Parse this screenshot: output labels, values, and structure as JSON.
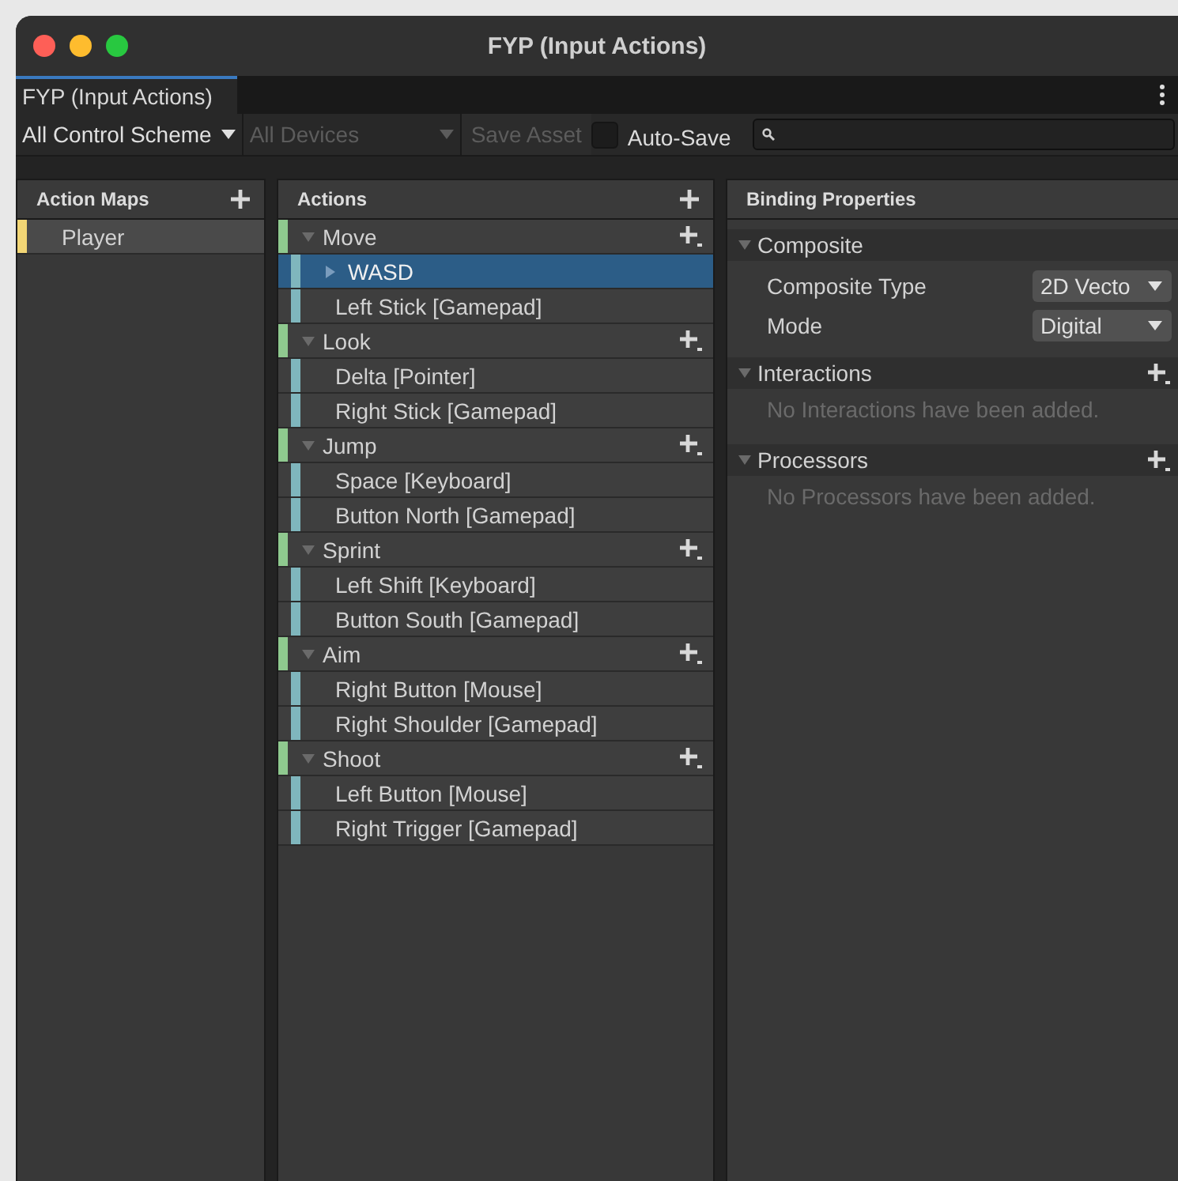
{
  "window": {
    "title": "FYP (Input Actions)"
  },
  "tabs": [
    {
      "label": "FYP (Input Actions)",
      "selected": true
    }
  ],
  "toolbar": {
    "control_scheme": "All Control Scheme",
    "devices": {
      "label": "All Devices",
      "disabled": true
    },
    "save_button": {
      "label": "Save Asset",
      "disabled": true
    },
    "auto_save": {
      "label": "Auto-Save",
      "checked": false
    }
  },
  "action_maps": {
    "title": "Action Maps",
    "items": [
      {
        "label": "Player",
        "selected": true
      }
    ]
  },
  "actions": {
    "title": "Actions",
    "items": [
      {
        "name": "Move",
        "expanded": true,
        "bindings": [
          {
            "label": "WASD",
            "kind": "composite",
            "expanded": false,
            "selected": true
          },
          {
            "label": "Left Stick [Gamepad]",
            "kind": "binding",
            "selected": false
          }
        ]
      },
      {
        "name": "Look",
        "expanded": true,
        "bindings": [
          {
            "label": "Delta [Pointer]",
            "kind": "binding",
            "selected": false
          },
          {
            "label": "Right Stick [Gamepad]",
            "kind": "binding",
            "selected": false
          }
        ]
      },
      {
        "name": "Jump",
        "expanded": true,
        "bindings": [
          {
            "label": "Space [Keyboard]",
            "kind": "binding",
            "selected": false
          },
          {
            "label": "Button North [Gamepad]",
            "kind": "binding",
            "selected": false
          }
        ]
      },
      {
        "name": "Sprint",
        "expanded": true,
        "bindings": [
          {
            "label": "Left Shift [Keyboard]",
            "kind": "binding",
            "selected": false
          },
          {
            "label": "Button South [Gamepad]",
            "kind": "binding",
            "selected": false
          }
        ]
      },
      {
        "name": "Aim",
        "expanded": true,
        "bindings": [
          {
            "label": "Right Button [Mouse]",
            "kind": "binding",
            "selected": false
          },
          {
            "label": "Right Shoulder [Gamepad]",
            "kind": "binding",
            "selected": false
          }
        ]
      },
      {
        "name": "Shoot",
        "expanded": true,
        "bindings": [
          {
            "label": "Left Button [Mouse]",
            "kind": "binding",
            "selected": false
          },
          {
            "label": "Right Trigger [Gamepad]",
            "kind": "binding",
            "selected": false
          }
        ]
      }
    ]
  },
  "binding_properties": {
    "title": "Binding Properties",
    "sections": [
      {
        "title": "Composite",
        "kind": "fields",
        "fields": [
          {
            "label": "Composite Type",
            "value": "2D Vecto"
          },
          {
            "label": "Mode",
            "value": "Digital"
          }
        ]
      },
      {
        "title": "Interactions",
        "kind": "list",
        "empty_text": "No Interactions have been added."
      },
      {
        "title": "Processors",
        "kind": "list",
        "empty_text": "No Processors have been added."
      }
    ]
  }
}
